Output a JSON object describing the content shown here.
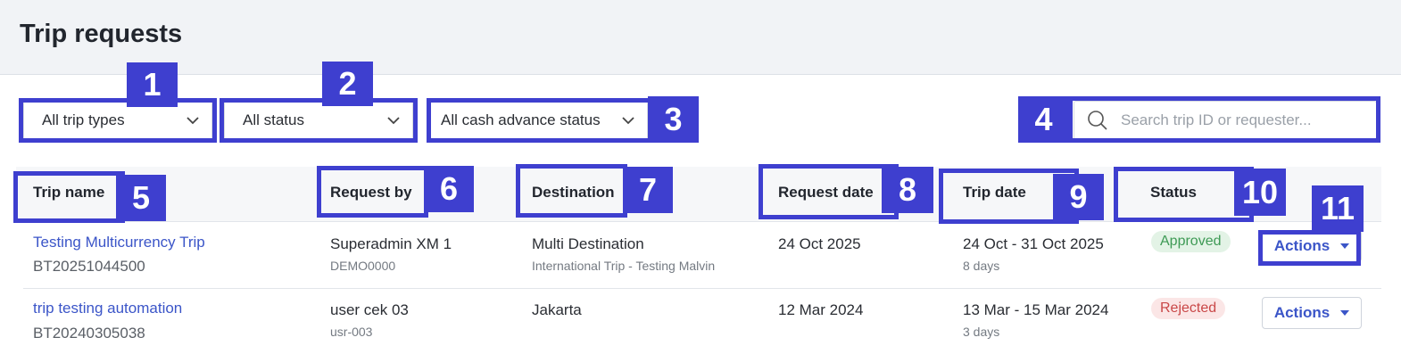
{
  "page": {
    "title": "Trip requests"
  },
  "filters": {
    "trip_type": "All trip types",
    "status": "All status",
    "cash_advance": "All cash advance status"
  },
  "search": {
    "placeholder": "Search trip ID or requester..."
  },
  "columns": [
    "Trip name",
    "Request by",
    "Destination",
    "Request date",
    "Trip date",
    "Status"
  ],
  "rows": [
    {
      "trip_name": "Testing Multicurrency Trip",
      "trip_id": "BT20251044500",
      "requester": "Superadmin XM 1",
      "requester_id": "DEMO0000",
      "destination": "Multi Destination",
      "destination_detail": "International Trip - Testing Malvin",
      "request_date": "24 Oct 2025",
      "trip_date": "24 Oct - 31 Oct 2025",
      "duration": "8 days",
      "status": "Approved",
      "action_label": "Actions"
    },
    {
      "trip_name": "trip testing automation",
      "trip_id": "BT20240305038",
      "requester": "user cek 03",
      "requester_id": "usr-003",
      "destination": "Jakarta",
      "destination_detail": "",
      "request_date": "12 Mar 2024",
      "trip_date": "13 Mar - 15 Mar 2024",
      "duration": "3 days",
      "status": "Rejected",
      "action_label": "Actions"
    }
  ],
  "annotations": [
    "1",
    "2",
    "3",
    "4",
    "5",
    "6",
    "7",
    "8",
    "9",
    "10",
    "11"
  ],
  "colors": {
    "annotation": "#3e3fcf",
    "link": "#3b55c8",
    "approved": "#3e9a55",
    "rejected": "#c94747"
  }
}
